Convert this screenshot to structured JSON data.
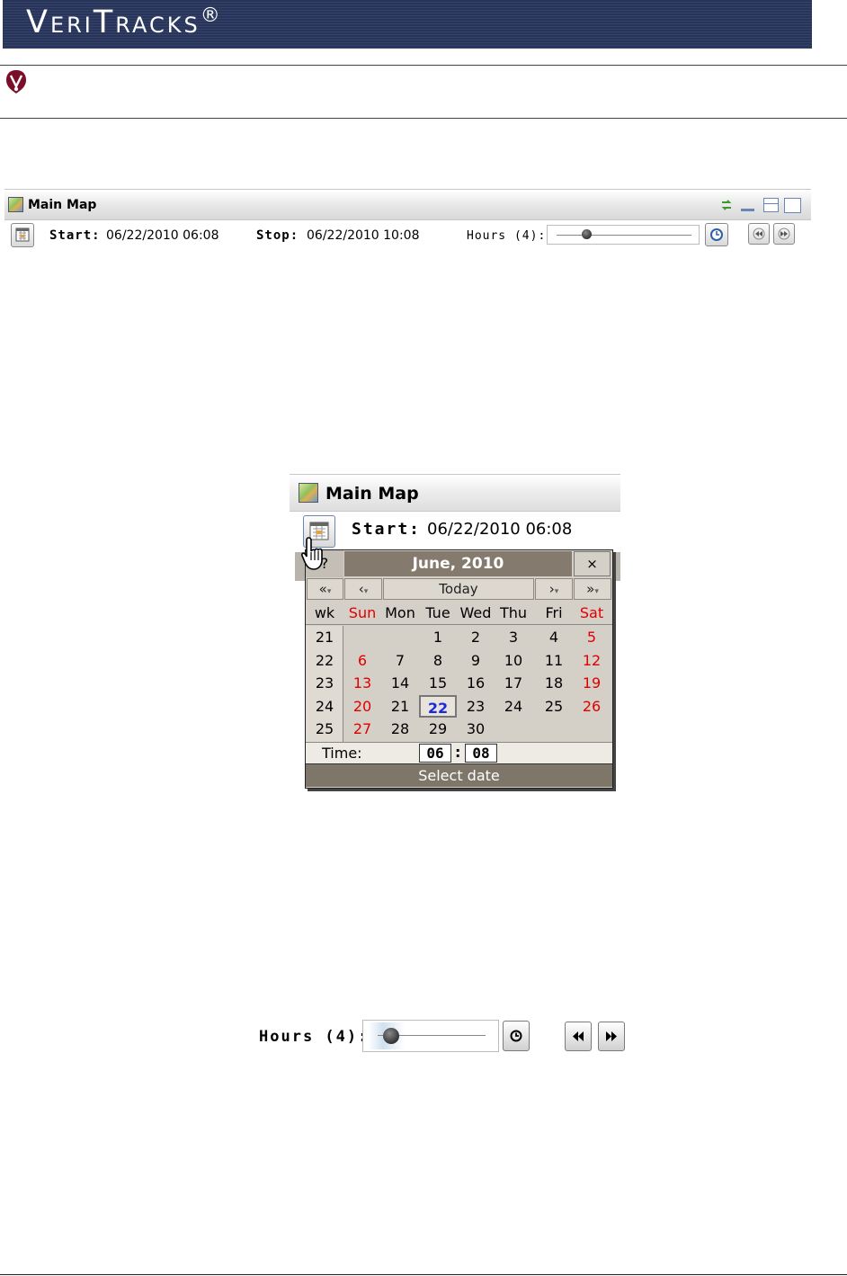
{
  "banner": {
    "title_initial_1": "V",
    "title_rest_1": "ERI",
    "title_initial_2": "T",
    "title_rest_2": "RACKS",
    "registered": "®"
  },
  "toolbar": {
    "title": "Main Map",
    "start_label": "Start:",
    "start_value": "06/22/2010 06:08",
    "stop_label": "Stop:",
    "stop_value": "06/22/2010 10:08",
    "hours_label": "Hours (4):",
    "hours_value": 4
  },
  "zoom_panel": {
    "title": "Main Map",
    "start_label": "Start:",
    "start_value": "06/22/2010 06:08"
  },
  "calendar": {
    "help": "?",
    "title": "June, 2010",
    "close": "×",
    "nav": {
      "prev_year": "«",
      "prev_month": "‹",
      "today": "Today",
      "next_month": "›",
      "next_year": "»"
    },
    "headers": [
      "wk",
      "Sun",
      "Mon",
      "Tue",
      "Wed",
      "Thu",
      "Fri",
      "Sat"
    ],
    "weeks": [
      {
        "wk": "21",
        "days": [
          "",
          "",
          "1",
          "2",
          "3",
          "4",
          "5"
        ]
      },
      {
        "wk": "22",
        "days": [
          "6",
          "7",
          "8",
          "9",
          "10",
          "11",
          "12"
        ]
      },
      {
        "wk": "23",
        "days": [
          "13",
          "14",
          "15",
          "16",
          "17",
          "18",
          "19"
        ]
      },
      {
        "wk": "24",
        "days": [
          "20",
          "21",
          "22",
          "23",
          "24",
          "25",
          "26"
        ]
      },
      {
        "wk": "25",
        "days": [
          "27",
          "28",
          "29",
          "30",
          "",
          "",
          ""
        ]
      }
    ],
    "selected_day": "22",
    "time_label": "Time:",
    "time_hour": "06",
    "time_sep": ":",
    "time_minute": "08",
    "select_label": "Select date"
  },
  "hours_zoom": {
    "label": "Hours (4):",
    "value": 4
  }
}
